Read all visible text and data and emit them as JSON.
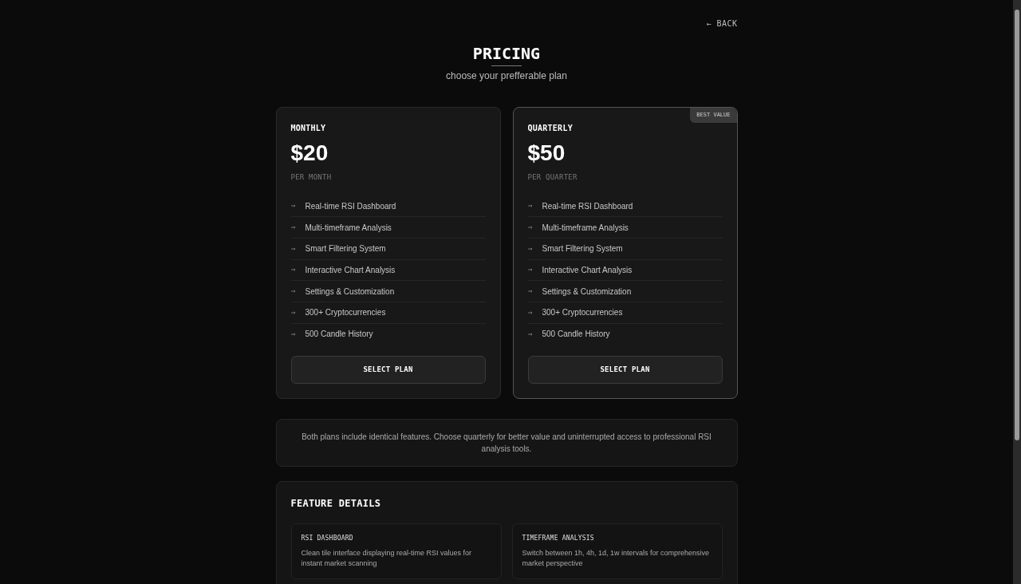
{
  "back_link": "← BACK",
  "header": {
    "title": "PRICING",
    "subtitle": "choose your prefferable plan"
  },
  "plans": [
    {
      "name": "MONTHLY",
      "price": "$20",
      "period": "PER MONTH",
      "highlighted": false,
      "features": [
        "Real-time RSI Dashboard",
        "Multi-timeframe Analysis",
        "Smart Filtering System",
        "Interactive Chart Analysis",
        "Settings & Customization",
        "300+ Cryptocurrencies",
        "500 Candle History"
      ],
      "button": "SELECT PLAN"
    },
    {
      "name": "QUARTERLY",
      "price": "$50",
      "period": "PER QUARTER",
      "highlighted": true,
      "badge": "BEST VALUE",
      "features": [
        "Real-time RSI Dashboard",
        "Multi-timeframe Analysis",
        "Smart Filtering System",
        "Interactive Chart Analysis",
        "Settings & Customization",
        "300+ Cryptocurrencies",
        "500 Candle History"
      ],
      "button": "SELECT PLAN"
    }
  ],
  "note": "Both plans include identical features. Choose quarterly for better value and uninterrupted access to professional RSI analysis tools.",
  "feature_details": {
    "title": "FEATURE DETAILS",
    "items": [
      {
        "title": "RSI DASHBOARD",
        "description": "Clean tile interface displaying real-time RSI values for instant market scanning"
      },
      {
        "title": "TIMEFRAME ANALYSIS",
        "description": "Switch between 1h, 4h, 1d, 1w intervals for comprehensive market perspective"
      }
    ]
  }
}
